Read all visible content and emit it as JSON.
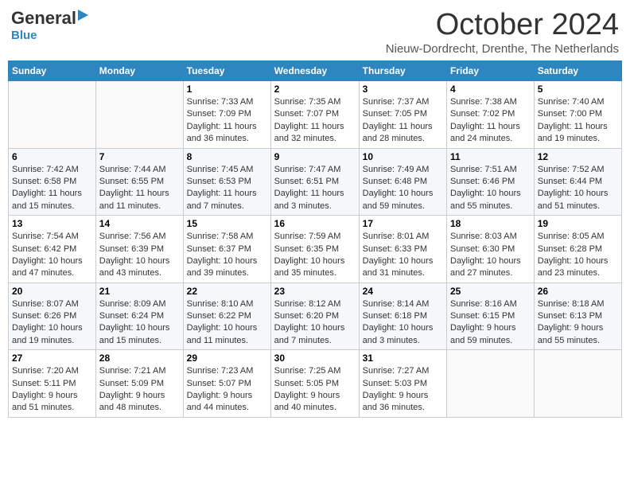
{
  "header": {
    "logo_line1a": "General",
    "logo_line1b": "Blue",
    "month": "October 2024",
    "location": "Nieuw-Dordrecht, Drenthe, The Netherlands"
  },
  "days_of_week": [
    "Sunday",
    "Monday",
    "Tuesday",
    "Wednesday",
    "Thursday",
    "Friday",
    "Saturday"
  ],
  "weeks": [
    [
      {
        "day": "",
        "info": ""
      },
      {
        "day": "",
        "info": ""
      },
      {
        "day": "1",
        "info": "Sunrise: 7:33 AM\nSunset: 7:09 PM\nDaylight: 11 hours and 36 minutes."
      },
      {
        "day": "2",
        "info": "Sunrise: 7:35 AM\nSunset: 7:07 PM\nDaylight: 11 hours and 32 minutes."
      },
      {
        "day": "3",
        "info": "Sunrise: 7:37 AM\nSunset: 7:05 PM\nDaylight: 11 hours and 28 minutes."
      },
      {
        "day": "4",
        "info": "Sunrise: 7:38 AM\nSunset: 7:02 PM\nDaylight: 11 hours and 24 minutes."
      },
      {
        "day": "5",
        "info": "Sunrise: 7:40 AM\nSunset: 7:00 PM\nDaylight: 11 hours and 19 minutes."
      }
    ],
    [
      {
        "day": "6",
        "info": "Sunrise: 7:42 AM\nSunset: 6:58 PM\nDaylight: 11 hours and 15 minutes."
      },
      {
        "day": "7",
        "info": "Sunrise: 7:44 AM\nSunset: 6:55 PM\nDaylight: 11 hours and 11 minutes."
      },
      {
        "day": "8",
        "info": "Sunrise: 7:45 AM\nSunset: 6:53 PM\nDaylight: 11 hours and 7 minutes."
      },
      {
        "day": "9",
        "info": "Sunrise: 7:47 AM\nSunset: 6:51 PM\nDaylight: 11 hours and 3 minutes."
      },
      {
        "day": "10",
        "info": "Sunrise: 7:49 AM\nSunset: 6:48 PM\nDaylight: 10 hours and 59 minutes."
      },
      {
        "day": "11",
        "info": "Sunrise: 7:51 AM\nSunset: 6:46 PM\nDaylight: 10 hours and 55 minutes."
      },
      {
        "day": "12",
        "info": "Sunrise: 7:52 AM\nSunset: 6:44 PM\nDaylight: 10 hours and 51 minutes."
      }
    ],
    [
      {
        "day": "13",
        "info": "Sunrise: 7:54 AM\nSunset: 6:42 PM\nDaylight: 10 hours and 47 minutes."
      },
      {
        "day": "14",
        "info": "Sunrise: 7:56 AM\nSunset: 6:39 PM\nDaylight: 10 hours and 43 minutes."
      },
      {
        "day": "15",
        "info": "Sunrise: 7:58 AM\nSunset: 6:37 PM\nDaylight: 10 hours and 39 minutes."
      },
      {
        "day": "16",
        "info": "Sunrise: 7:59 AM\nSunset: 6:35 PM\nDaylight: 10 hours and 35 minutes."
      },
      {
        "day": "17",
        "info": "Sunrise: 8:01 AM\nSunset: 6:33 PM\nDaylight: 10 hours and 31 minutes."
      },
      {
        "day": "18",
        "info": "Sunrise: 8:03 AM\nSunset: 6:30 PM\nDaylight: 10 hours and 27 minutes."
      },
      {
        "day": "19",
        "info": "Sunrise: 8:05 AM\nSunset: 6:28 PM\nDaylight: 10 hours and 23 minutes."
      }
    ],
    [
      {
        "day": "20",
        "info": "Sunrise: 8:07 AM\nSunset: 6:26 PM\nDaylight: 10 hours and 19 minutes."
      },
      {
        "day": "21",
        "info": "Sunrise: 8:09 AM\nSunset: 6:24 PM\nDaylight: 10 hours and 15 minutes."
      },
      {
        "day": "22",
        "info": "Sunrise: 8:10 AM\nSunset: 6:22 PM\nDaylight: 10 hours and 11 minutes."
      },
      {
        "day": "23",
        "info": "Sunrise: 8:12 AM\nSunset: 6:20 PM\nDaylight: 10 hours and 7 minutes."
      },
      {
        "day": "24",
        "info": "Sunrise: 8:14 AM\nSunset: 6:18 PM\nDaylight: 10 hours and 3 minutes."
      },
      {
        "day": "25",
        "info": "Sunrise: 8:16 AM\nSunset: 6:15 PM\nDaylight: 9 hours and 59 minutes."
      },
      {
        "day": "26",
        "info": "Sunrise: 8:18 AM\nSunset: 6:13 PM\nDaylight: 9 hours and 55 minutes."
      }
    ],
    [
      {
        "day": "27",
        "info": "Sunrise: 7:20 AM\nSunset: 5:11 PM\nDaylight: 9 hours and 51 minutes."
      },
      {
        "day": "28",
        "info": "Sunrise: 7:21 AM\nSunset: 5:09 PM\nDaylight: 9 hours and 48 minutes."
      },
      {
        "day": "29",
        "info": "Sunrise: 7:23 AM\nSunset: 5:07 PM\nDaylight: 9 hours and 44 minutes."
      },
      {
        "day": "30",
        "info": "Sunrise: 7:25 AM\nSunset: 5:05 PM\nDaylight: 9 hours and 40 minutes."
      },
      {
        "day": "31",
        "info": "Sunrise: 7:27 AM\nSunset: 5:03 PM\nDaylight: 9 hours and 36 minutes."
      },
      {
        "day": "",
        "info": ""
      },
      {
        "day": "",
        "info": ""
      }
    ]
  ]
}
